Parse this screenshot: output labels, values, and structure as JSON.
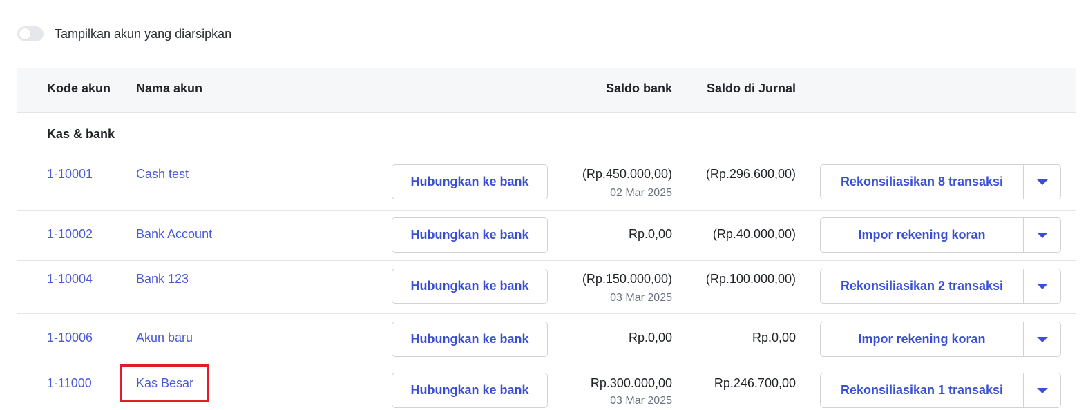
{
  "toggle": {
    "label": "Tampilkan akun yang diarsipkan",
    "on": false
  },
  "table": {
    "headers": {
      "kode": "Kode akun",
      "nama": "Nama akun",
      "saldo_bank": "Saldo bank",
      "saldo_jurnal": "Saldo di Jurnal"
    },
    "group": "Kas & bank",
    "rows": [
      {
        "code": "1-10001",
        "name": "Cash test",
        "connect": "Hubungkan ke bank",
        "bank": "(Rp.450.000,00)",
        "bank_date": "02 Mar 2025",
        "jurnal": "(Rp.296.600,00)",
        "action": "Rekonsiliasikan 8 transaksi"
      },
      {
        "code": "1-10002",
        "name": "Bank Account",
        "connect": "Hubungkan ke bank",
        "bank": "Rp.0,00",
        "bank_date": "",
        "jurnal": "(Rp.40.000,00)",
        "action": "Impor rekening koran"
      },
      {
        "code": "1-10004",
        "name": "Bank 123",
        "connect": "Hubungkan ke bank",
        "bank": "(Rp.150.000,00)",
        "bank_date": "03 Mar 2025",
        "jurnal": "(Rp.100.000,00)",
        "action": "Rekonsiliasikan 2 transaksi"
      },
      {
        "code": "1-10006",
        "name": "Akun baru",
        "connect": "Hubungkan ke bank",
        "bank": "Rp.0,00",
        "bank_date": "",
        "jurnal": "Rp.0,00",
        "action": "Impor rekening koran"
      },
      {
        "code": "1-11000",
        "name": "Kas Besar",
        "connect": "Hubungkan ke bank",
        "bank": "Rp.300.000,00",
        "bank_date": "03 Mar 2025",
        "jurnal": "Rp.246.700,00",
        "action": "Rekonsiliasikan 1 transaksi"
      }
    ]
  },
  "colors": {
    "link": "#4a5bd4",
    "button_text": "#3b4fd3",
    "highlight": "#e11d2a",
    "header_bg": "#f6f7f8"
  }
}
